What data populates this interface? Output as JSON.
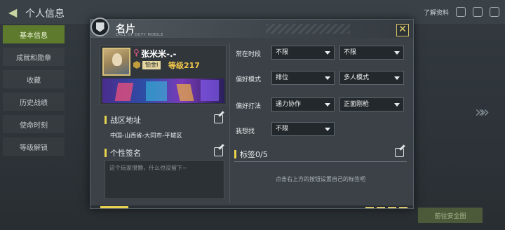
{
  "background": {
    "title": "个人信息",
    "sidebar": [
      "基本信息",
      "成就和勋章",
      "收藏",
      "历史战绩",
      "使命时刻",
      "等级解锁"
    ],
    "top_right_label": "了解资料",
    "bottom_button": "前往安全图"
  },
  "card": {
    "title": "名片",
    "subtitle": "CALL OF DUTY MOBILE",
    "close_icon": "close-icon",
    "profile": {
      "gender_symbol": "♀",
      "username": "张米米-.-",
      "rank": "铂金Ⅰ",
      "level": "等级217"
    },
    "region": {
      "label": "战区地址",
      "value": "中国-山西省-大同市-平城区"
    },
    "signature": {
      "label": "个性签名",
      "placeholder": "这个玩家很懒，什么也没留下~"
    },
    "preferences": {
      "time": {
        "label": "常在时段",
        "value1": "不限",
        "value2": "不限"
      },
      "mode": {
        "label": "偏好模式",
        "value1": "排位",
        "value2": "多人模式"
      },
      "style": {
        "label": "偏好打法",
        "value1": "通力协作",
        "value2": "正面刚枪"
      },
      "looking_for": {
        "label": "我想找",
        "value1": "不限"
      }
    },
    "tags": {
      "label": "标签0/5",
      "hint": "点击右上方的按钮设置自己的标签吧"
    }
  },
  "colors": {
    "accent_yellow": "#e8d24e",
    "level_gold": "#f3c84b",
    "gender_pink": "#e55a8a"
  }
}
